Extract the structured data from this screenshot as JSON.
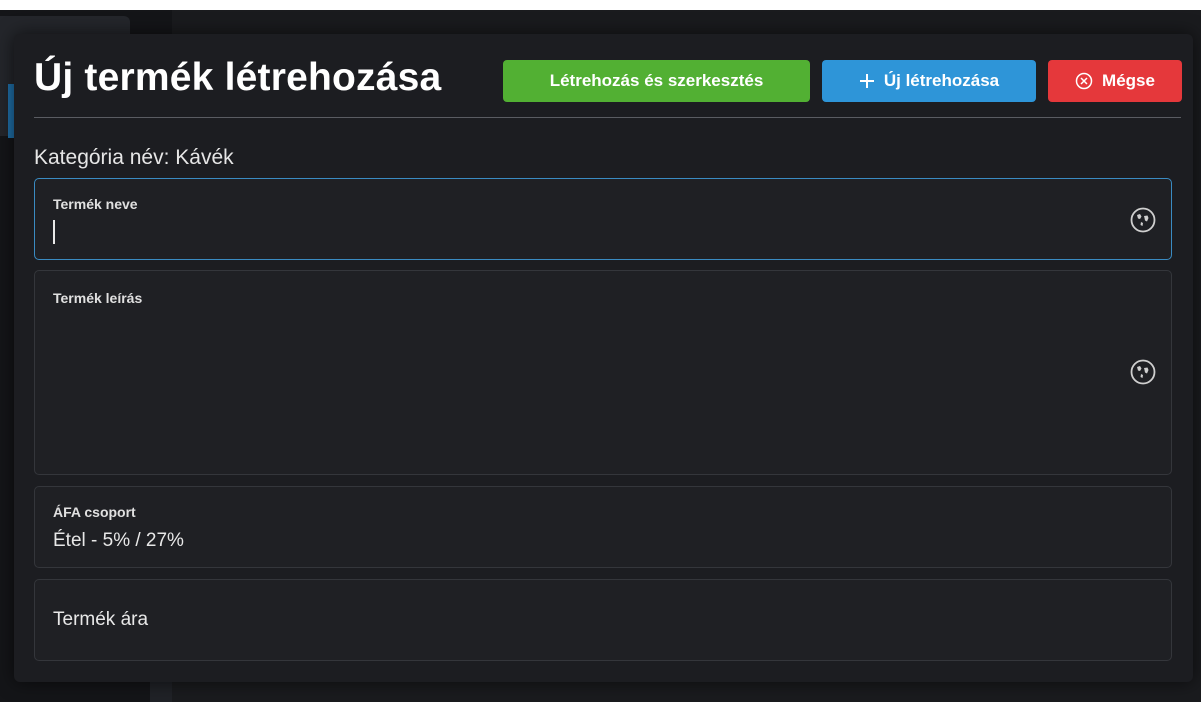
{
  "dialog": {
    "title": "Új termék létrehozása",
    "buttons": {
      "create_edit": "Létrehozás és szerkesztés",
      "create_new": "Új létrehozása",
      "create_new_icon": "plus-icon",
      "cancel": "Mégse",
      "cancel_icon": "circle-x-icon"
    },
    "category_line": "Kategória név: Kávék",
    "fields": {
      "name": {
        "label": "Termék neve",
        "value": "",
        "icon": "globe-icon"
      },
      "description": {
        "label": "Termék leírás",
        "value": "",
        "icon": "globe-icon"
      },
      "vat": {
        "label": "ÁFA csoport",
        "value": "Étel - 5% / 27%"
      },
      "price": {
        "placeholder": "Termék ára"
      }
    }
  },
  "colors": {
    "green": "#52b033",
    "blue": "#2e95d8",
    "red": "#e5383b",
    "focus_border": "#3a8bc2",
    "dialog_bg": "#1c1d21"
  }
}
